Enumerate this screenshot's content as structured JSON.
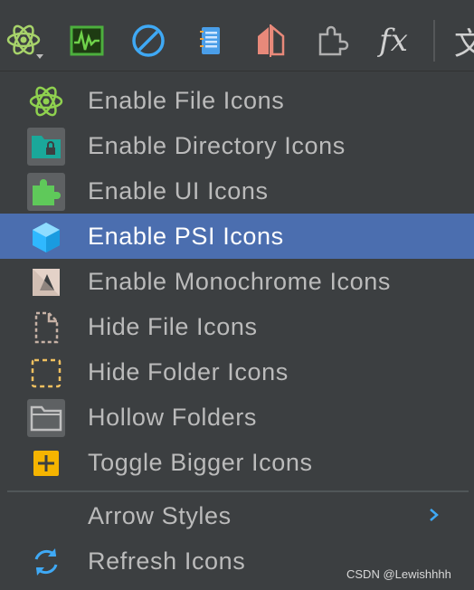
{
  "toolbar": {
    "buttons": [
      {
        "icon": "atom-dropdown-icon"
      },
      {
        "icon": "activity-monitor-icon"
      },
      {
        "icon": "disable-icon"
      },
      {
        "icon": "notebook-icon"
      },
      {
        "icon": "split-contrast-icon"
      },
      {
        "icon": "plugin-icon"
      },
      {
        "icon": "function-icon",
        "text": "fx"
      },
      {
        "icon": "translate-icon",
        "text": "文"
      }
    ]
  },
  "menu": {
    "items": [
      {
        "label": "Enable File Icons",
        "icon": "atom-icon"
      },
      {
        "label": "Enable Directory Icons",
        "icon": "locked-folder-icon"
      },
      {
        "label": "Enable UI Icons",
        "icon": "puzzle-icon"
      },
      {
        "label": "Enable PSI Icons",
        "icon": "cube-icon",
        "selected": true
      },
      {
        "label": "Enable Monochrome Icons",
        "icon": "monochrome-icon"
      },
      {
        "label": "Hide File Icons",
        "icon": "dashed-file-icon"
      },
      {
        "label": "Hide Folder Icons",
        "icon": "dashed-folder-icon"
      },
      {
        "label": "Hollow Folders",
        "icon": "hollow-folder-icon"
      },
      {
        "label": "Toggle Bigger Icons",
        "icon": "plus-square-icon"
      },
      {
        "label": "Arrow Styles",
        "icon": "",
        "has_submenu": true
      },
      {
        "label": "Refresh Icons",
        "icon": "refresh-icon"
      }
    ]
  },
  "colors": {
    "background": "#3c3f41",
    "selection": "#4b6eaf",
    "text": "#bbbbbb",
    "selected_text": "#ffffff",
    "accent_green": "#8fd14f",
    "accent_blue": "#3fa9f5",
    "accent_yellow": "#f5b400"
  },
  "watermark": "CSDN @Lewishhhh"
}
